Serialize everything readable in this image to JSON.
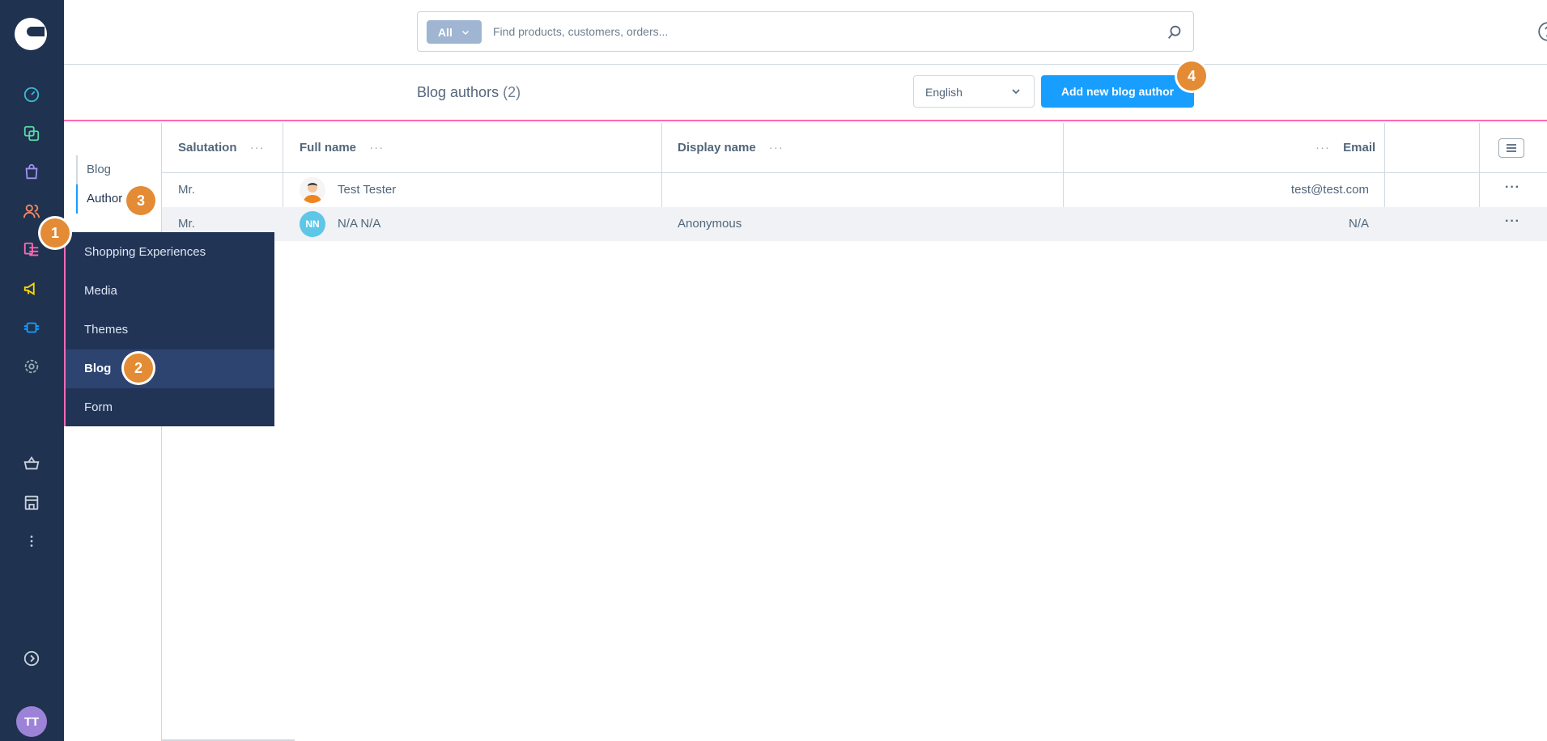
{
  "search": {
    "type_label": "All",
    "placeholder": "Find products, customers, orders..."
  },
  "header": {
    "title": "Blog authors",
    "count": "(2)",
    "language": "English",
    "add_button": "Add new blog author"
  },
  "subnav": {
    "items": [
      "Blog",
      "Author"
    ]
  },
  "grid": {
    "columns": {
      "salutation": "Salutation",
      "full_name": "Full name",
      "display_name": "Display name",
      "email": "Email"
    },
    "rows": [
      {
        "salutation": "Mr.",
        "full_name": "Test Tester",
        "display_name": "",
        "email": "test@test.com"
      },
      {
        "salutation": "Mr.",
        "full_name": "N/A N/A",
        "display_name": "Anonymous",
        "email": "N/A",
        "initials": "NN"
      }
    ]
  },
  "flyout": {
    "items": [
      "Shopping Experiences",
      "Media",
      "Themes",
      "Blog",
      "Form"
    ]
  },
  "user": {
    "initials": "TT"
  },
  "badges": [
    "1",
    "2",
    "3",
    "4"
  ],
  "colors": {
    "primary": "#189eff",
    "sidebar": "#1f3250",
    "accent_pink": "#ff68b4",
    "badge": "#e38b35"
  }
}
